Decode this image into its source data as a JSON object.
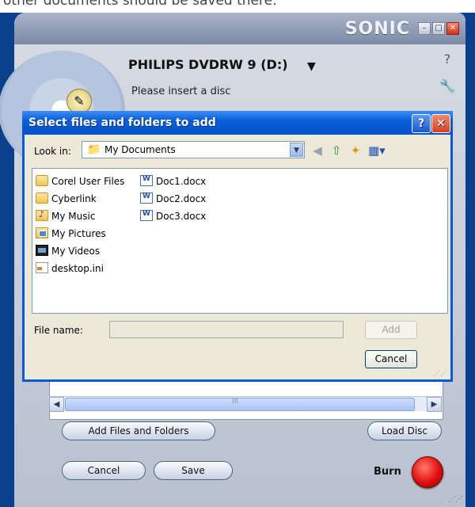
{
  "background_snippet": "other documents should be saved there.",
  "sonic": {
    "logo": "SONIC",
    "drive_name": "PHILIPS DVDRW 9 (D:)",
    "disc_status": "Please insert a disc",
    "add_files_label": "Add Files and Folders",
    "load_disc_label": "Load Disc",
    "cancel_label": "Cancel",
    "save_label": "Save",
    "burn_label": "Burn",
    "scroll_thumb_text": "III"
  },
  "dialog": {
    "title": "Select files and folders to add",
    "help_label": "?",
    "close_label": "✕",
    "look_in_label": "Look in:",
    "look_in_value": "My Documents",
    "files": [
      {
        "name": "Corel User Files",
        "icon": "folder"
      },
      {
        "name": "Cyberlink",
        "icon": "folder"
      },
      {
        "name": "My Music",
        "icon": "music-folder"
      },
      {
        "name": "My Pictures",
        "icon": "pictures-folder"
      },
      {
        "name": "My Videos",
        "icon": "videos-folder"
      },
      {
        "name": "desktop.ini",
        "icon": "ini-file"
      },
      {
        "name": "Doc1.docx",
        "icon": "word-doc"
      },
      {
        "name": "Doc2.docx",
        "icon": "word-doc"
      },
      {
        "name": "Doc3.docx",
        "icon": "word-doc"
      }
    ],
    "file_name_label": "File name:",
    "file_name_value": "",
    "add_label": "Add",
    "cancel_label": "Cancel"
  },
  "colors": {
    "dialog_title_blue": "#0a5fd9",
    "burn_red": "#e10f0f",
    "desktop_blue": "#0a3f8e"
  }
}
